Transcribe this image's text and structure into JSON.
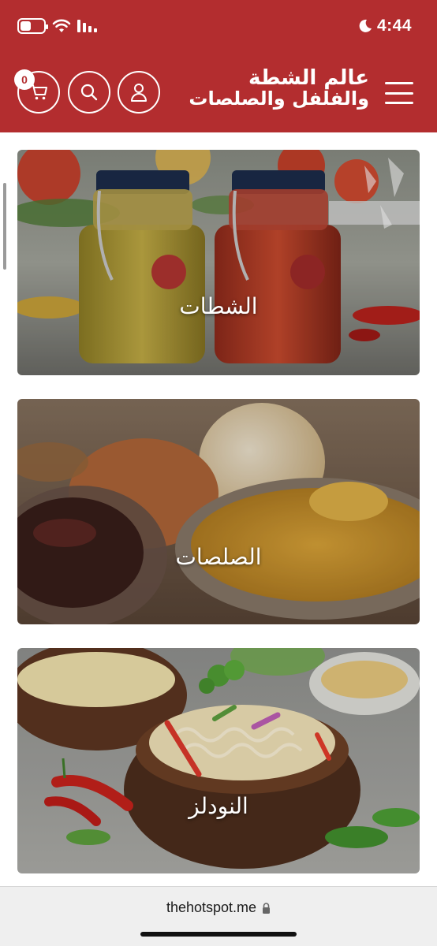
{
  "status_bar": {
    "time": "4:44",
    "icons": [
      "battery-icon",
      "wifi-icon",
      "signal-icon",
      "moon-icon"
    ]
  },
  "header": {
    "logo_line1": "عالم الشطة",
    "logo_line2": "والفلفل والصلصات",
    "cart_count": "0",
    "icons": [
      "cart-icon",
      "search-icon",
      "account-icon",
      "menu-icon"
    ]
  },
  "categories": [
    {
      "label": "الشطات"
    },
    {
      "label": "الصلصات"
    },
    {
      "label": "النودلز"
    }
  ],
  "browser": {
    "url": "thehotspot.me"
  },
  "colors": {
    "brand_red": "#b32d2f",
    "text_white": "#ffffff"
  }
}
